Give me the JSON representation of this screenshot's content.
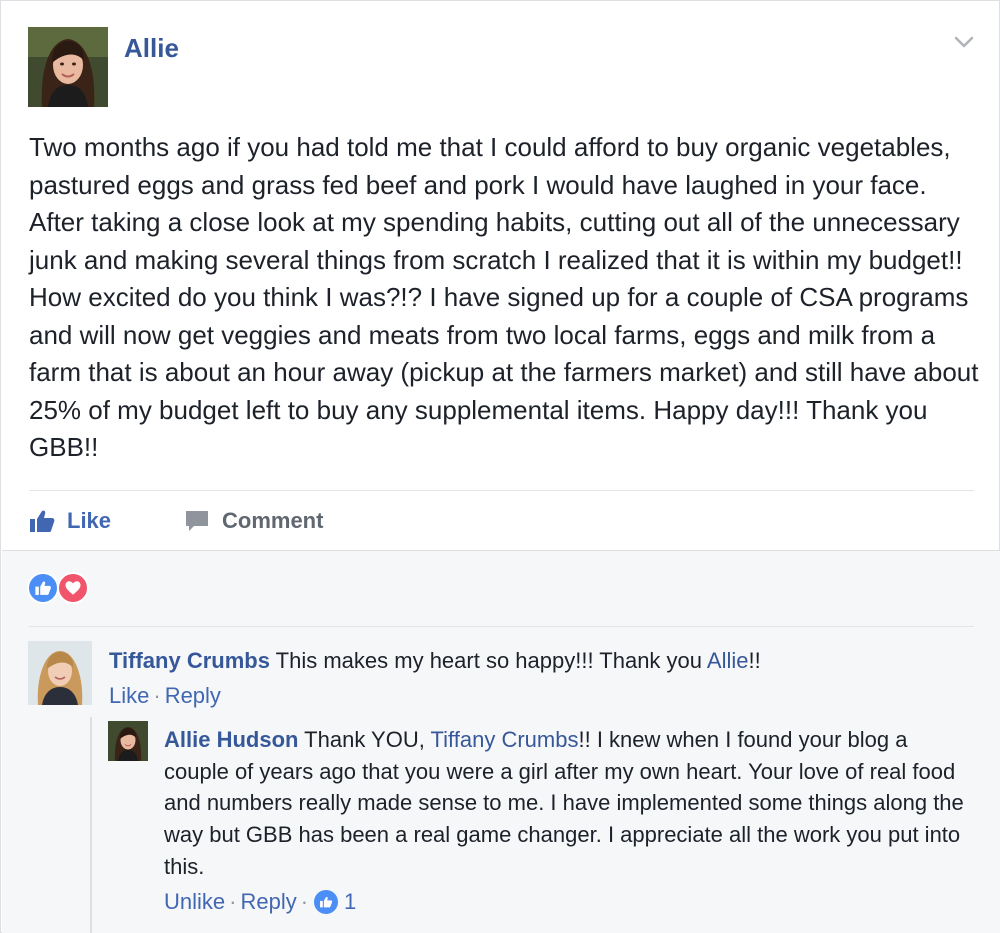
{
  "post": {
    "author": "Allie",
    "text": "Two months ago if you had told me that I could afford to buy organic vegetables, pastured eggs and grass fed beef and pork I would have laughed in your face. After taking a close look at my spending habits, cutting out all of the unnecessary junk and making several things from scratch I realized that it is within my budget!! How excited do you think I was?!? I have signed up for a couple of CSA programs and will now get veggies and meats from two local farms, eggs and milk from a farm that is about an hour away (pickup at the farmers market) and still have about 25% of my budget left to buy any supplemental items. Happy day!!! Thank you GBB!!",
    "actions": {
      "like": "Like",
      "comment": "Comment"
    }
  },
  "reactions": [
    "like-icon",
    "love-icon"
  ],
  "comments": [
    {
      "author": "Tiffany Crumbs",
      "text_before": "This makes my heart so happy!!! Thank you ",
      "mention": "Allie",
      "text_after": "!!",
      "like": "Like",
      "separator": "·",
      "reply": "Reply"
    }
  ],
  "reply_comment": {
    "author": "Allie Hudson",
    "text_before": "Thank YOU, ",
    "mention": "Tiffany Crumbs",
    "text_after": "!! I knew when I found your blog a couple of years ago that you were a girl after my own heart. Your love of real food and numbers really made sense to me. I have implemented some things along the way but GBB has been a real game changer. I appreciate all the work you put into this.",
    "unlike": "Unlike",
    "separator": "·",
    "reply": "Reply",
    "like_count": "1"
  },
  "colors": {
    "link": "#365899",
    "action_blue": "#4267b2",
    "like_reaction": "#4b8ef5",
    "love_reaction": "#f0556c"
  }
}
